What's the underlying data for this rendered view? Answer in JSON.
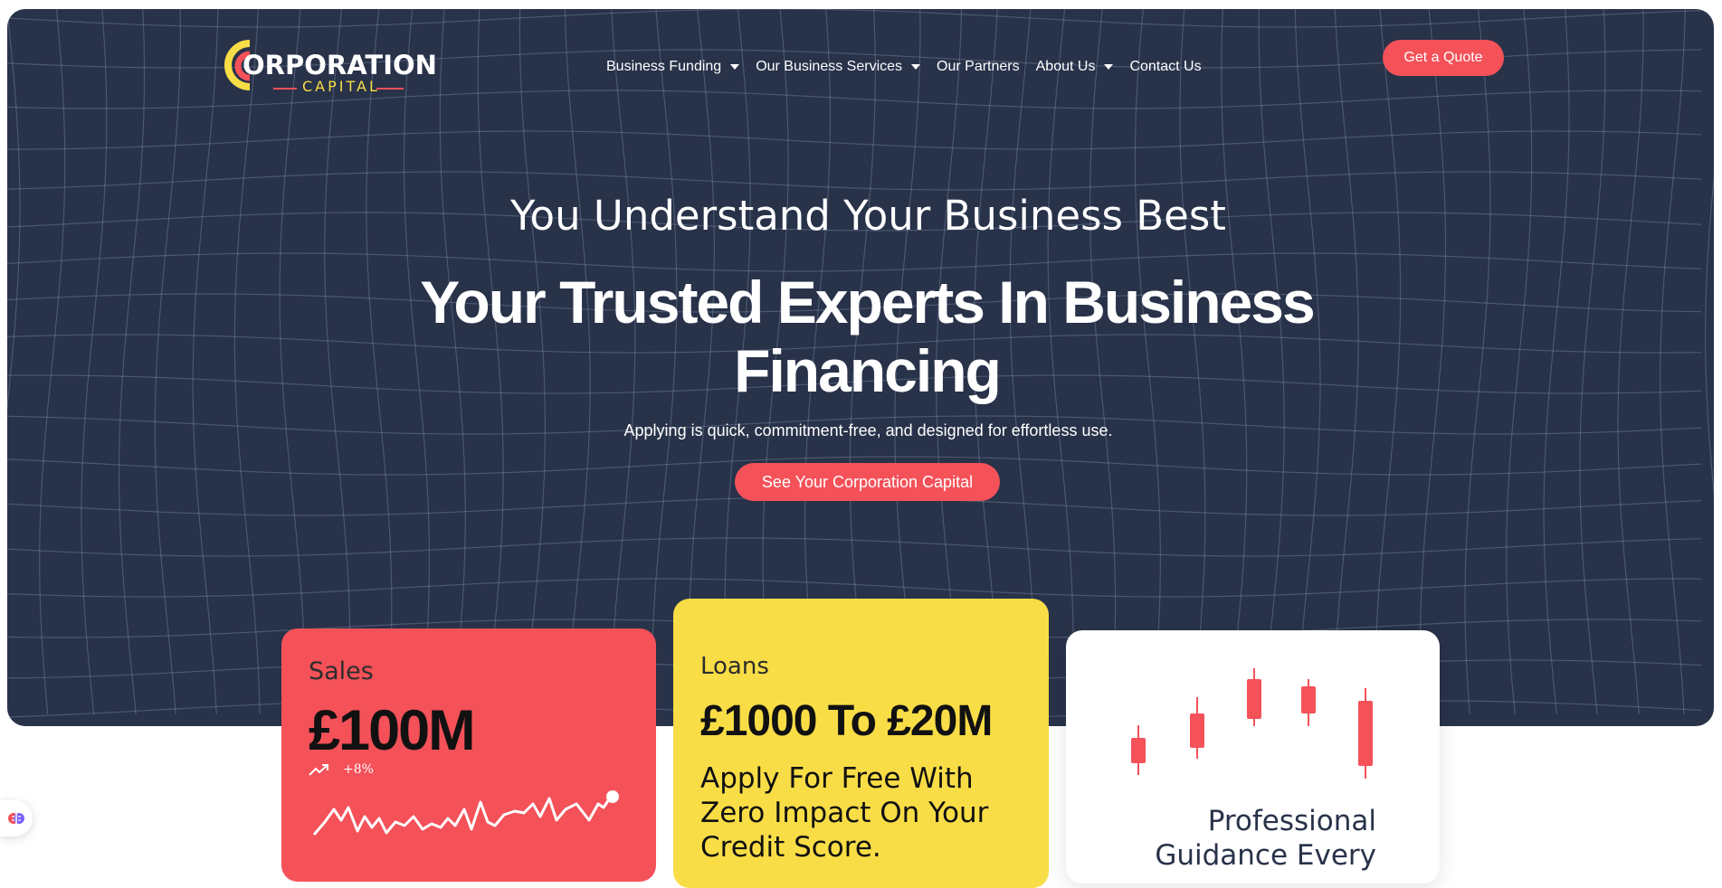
{
  "brand": {
    "name_main": "ORPORATION",
    "name_sub": "CAPITAL",
    "colors": {
      "navy": "#283249",
      "coral": "#f45159",
      "yellow": "#f9dd46"
    }
  },
  "nav": {
    "items": [
      {
        "label": "Business Funding",
        "dropdown": true
      },
      {
        "label": "Our Business Services",
        "dropdown": true
      },
      {
        "label": "Our Partners",
        "dropdown": false
      },
      {
        "label": "About Us",
        "dropdown": true
      },
      {
        "label": "Contact Us",
        "dropdown": false
      }
    ],
    "quote_button": "Get a Quote"
  },
  "hero": {
    "subtitle": "You Understand Your Business Best",
    "title": "Your Trusted Experts In Business Financing",
    "description": "Applying is quick, commitment-free, and designed for effortless use.",
    "cta": "See Your Corporation Capital"
  },
  "cards": {
    "sales": {
      "label": "Sales",
      "value": "£100M",
      "trend": "+8%",
      "icon": "trending-up-icon"
    },
    "loans": {
      "label": "Loans",
      "value": "£1000 To £20M",
      "description": "Apply For Free With Zero Impact On Your Credit Score."
    },
    "guidance": {
      "title": "Professional Guidance Every",
      "icon": "candlestick-chart-icon"
    }
  },
  "chat_widget": {
    "icon": "brain-icon"
  }
}
